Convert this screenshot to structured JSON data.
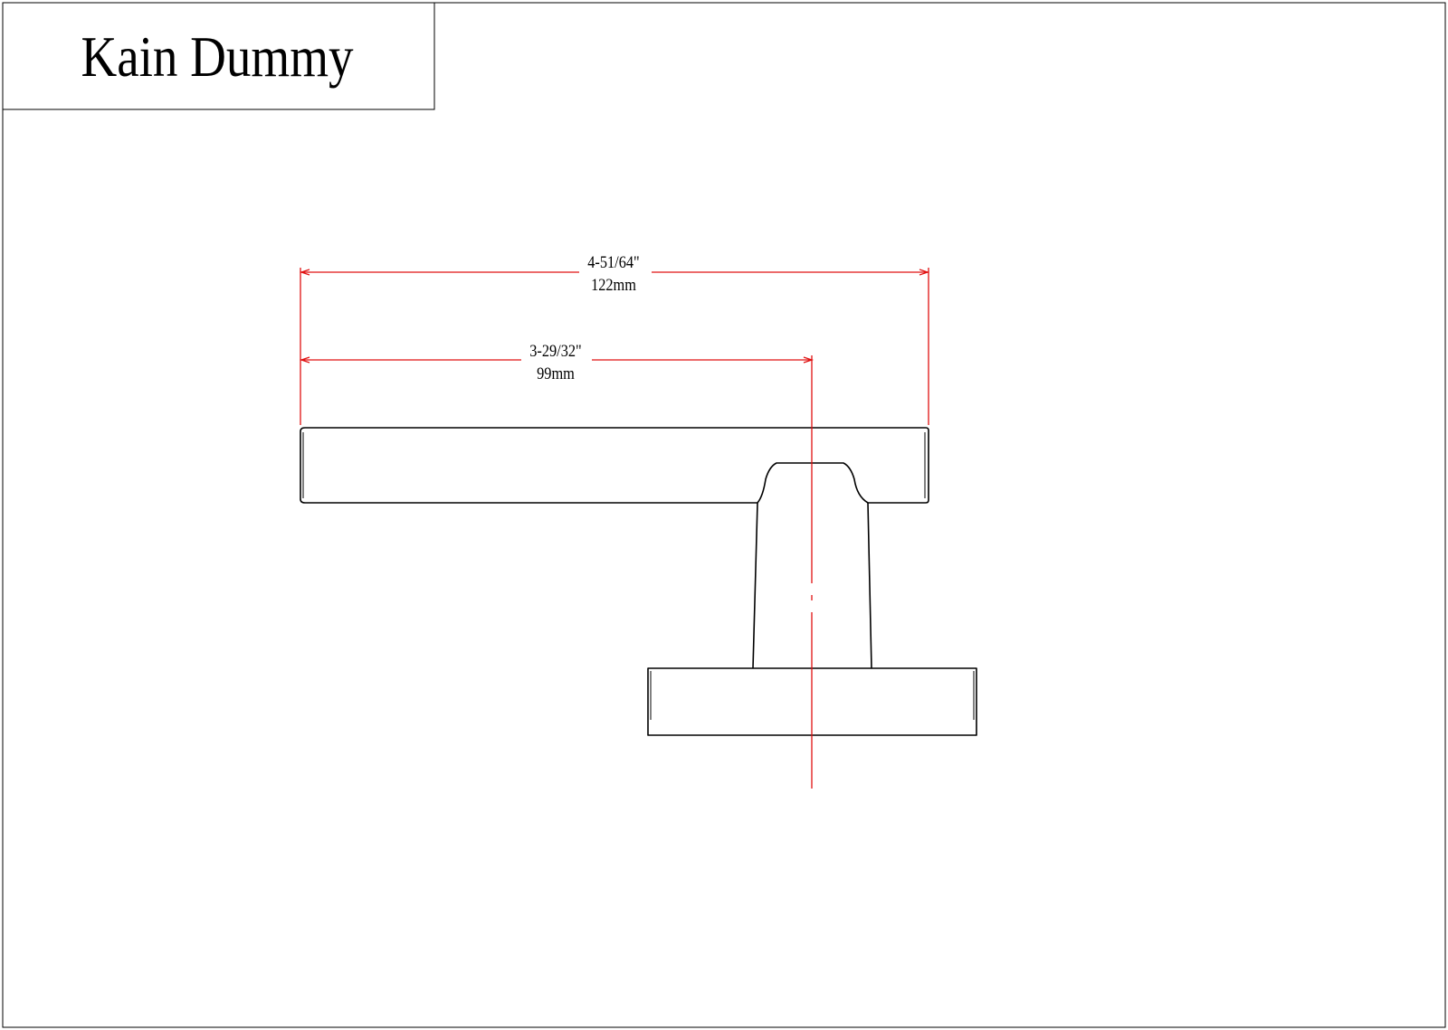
{
  "title": "Kain Dummy",
  "dimensions": {
    "overall_length": {
      "imperial": "4-51/64\"",
      "metric": "122mm"
    },
    "projection": {
      "imperial": "3-29/32\"",
      "metric": "99mm"
    }
  },
  "colors": {
    "outline": "#000000",
    "dimension": "#e01010",
    "background": "#ffffff"
  }
}
